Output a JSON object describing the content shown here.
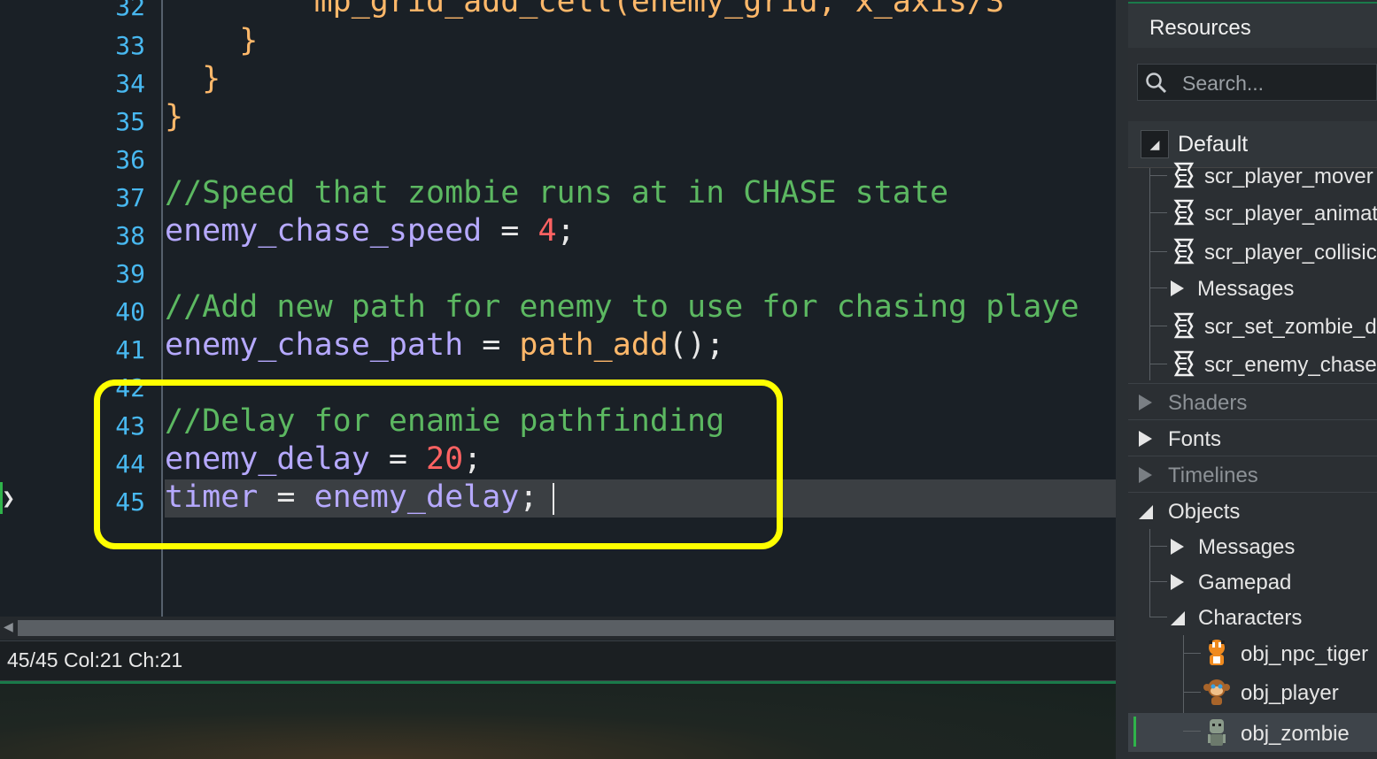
{
  "editor": {
    "lines": [
      {
        "num": "32",
        "tokens": [
          {
            "t": "        mp_grid_add_cell(enemy_grid, x_axis/3",
            "c": "c-fn"
          }
        ]
      },
      {
        "num": "33",
        "tokens": [
          {
            "t": "    }",
            "c": "c-br"
          }
        ]
      },
      {
        "num": "34",
        "tokens": [
          {
            "t": "  }",
            "c": "c-br"
          }
        ]
      },
      {
        "num": "35",
        "tokens": [
          {
            "t": "}",
            "c": "c-br"
          }
        ]
      },
      {
        "num": "36",
        "tokens": []
      },
      {
        "num": "37",
        "tokens": [
          {
            "t": "//Speed that zombie runs at in CHASE state",
            "c": "c-cm"
          }
        ]
      },
      {
        "num": "38",
        "tokens": [
          {
            "t": "enemy_chase_speed",
            "c": "c-id"
          },
          {
            "t": " = ",
            "c": "c-op"
          },
          {
            "t": "4",
            "c": "c-num"
          },
          {
            "t": ";",
            "c": "c-op"
          }
        ]
      },
      {
        "num": "39",
        "tokens": []
      },
      {
        "num": "40",
        "tokens": [
          {
            "t": "//Add new path for enemy to use for chasing playe",
            "c": "c-cm"
          }
        ]
      },
      {
        "num": "41",
        "tokens": [
          {
            "t": "enemy_chase_path",
            "c": "c-id"
          },
          {
            "t": " = ",
            "c": "c-op"
          },
          {
            "t": "path_add",
            "c": "c-fn"
          },
          {
            "t": "();",
            "c": "c-op"
          }
        ]
      },
      {
        "num": "42",
        "tokens": []
      },
      {
        "num": "43",
        "tokens": [
          {
            "t": "//Delay for enamie pathfinding",
            "c": "c-cm"
          }
        ]
      },
      {
        "num": "44",
        "tokens": [
          {
            "t": "enemy_delay",
            "c": "c-id"
          },
          {
            "t": " = ",
            "c": "c-op"
          },
          {
            "t": "20",
            "c": "c-num"
          },
          {
            "t": ";",
            "c": "c-op"
          }
        ]
      },
      {
        "num": "45",
        "tokens": [
          {
            "t": "timer",
            "c": "c-id"
          },
          {
            "t": " = ",
            "c": "c-op"
          },
          {
            "t": "enemy_delay",
            "c": "c-id"
          },
          {
            "t": ";",
            "c": "c-op"
          }
        ]
      }
    ],
    "status": "45/45 Col:21 Ch:21"
  },
  "resources": {
    "title": "Resources",
    "search_placeholder": "Search...",
    "group": "Default",
    "items": [
      {
        "label": "scr_player_mover",
        "kind": "script"
      },
      {
        "label": "scr_player_animat",
        "kind": "script"
      },
      {
        "label": "scr_player_collisic",
        "kind": "script"
      },
      {
        "label": "Messages",
        "kind": "folder"
      },
      {
        "label": "scr_set_zombie_d",
        "kind": "script"
      },
      {
        "label": "scr_enemy_chase",
        "kind": "script"
      }
    ],
    "sections": [
      {
        "label": "Shaders",
        "dim": true
      },
      {
        "label": "Fonts",
        "dim": false
      },
      {
        "label": "Timelines",
        "dim": true
      },
      {
        "label": "Objects",
        "dim": false
      }
    ],
    "object_folders": [
      "Messages",
      "Gamepad",
      "Characters"
    ],
    "characters": [
      "obj_npc_tiger",
      "obj_player",
      "obj_zombie"
    ]
  }
}
